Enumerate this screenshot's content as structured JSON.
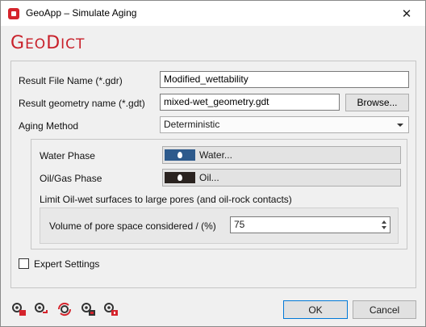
{
  "window": {
    "title": "GeoApp – Simulate Aging",
    "close_glyph": "✕"
  },
  "logo": {
    "big1": "G",
    "small1": "EO",
    "big2": "D",
    "small2": "ICT",
    "color": "#c8202a"
  },
  "form": {
    "result_file_label": "Result File Name (*.gdr)",
    "result_file_value": "Modified_wettability",
    "geometry_label": "Result geometry name (*.gdt)",
    "geometry_value": "mixed-wet_geometry.gdt",
    "browse_label": "Browse...",
    "aging_label": "Aging Method",
    "aging_value": "Deterministic"
  },
  "phases": {
    "water_label": "Water Phase",
    "water_button": "Water...",
    "water_color": "#2d5a8c",
    "oil_label": "Oil/Gas Phase",
    "oil_button": "Oil...",
    "oil_color": "#2a2320",
    "limit_label": "Limit Oil-wet surfaces to large pores (and oil-rock contacts)",
    "volume_label": "Volume of pore space considered / (%)",
    "volume_value": "75"
  },
  "expert": {
    "label": "Expert Settings",
    "checked": false
  },
  "toolbar_icons": [
    "gear-lock-icon",
    "gear-save-icon",
    "gear-refresh-icon",
    "gear-image-icon",
    "gear-lock-alt-icon"
  ],
  "footer": {
    "ok_label": "OK",
    "cancel_label": "Cancel"
  }
}
